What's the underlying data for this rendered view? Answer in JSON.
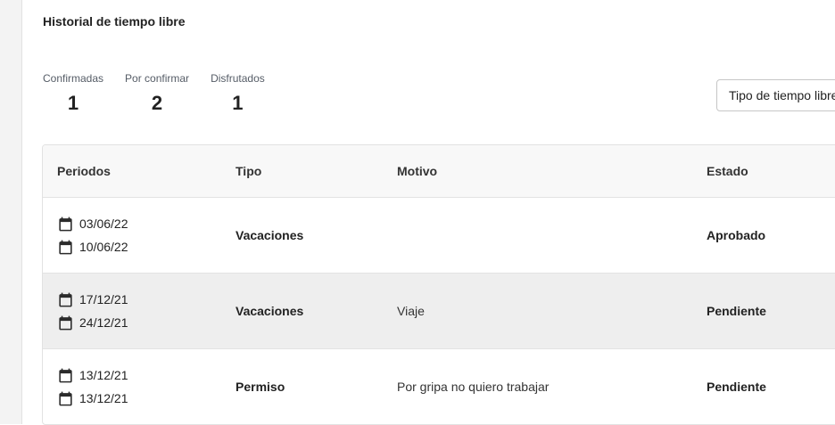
{
  "section": {
    "title": "Historial de tiempo libre"
  },
  "stats": [
    {
      "label": "Confirmadas",
      "value": "1"
    },
    {
      "label": "Por confirmar",
      "value": "2"
    },
    {
      "label": "Disfrutados",
      "value": "1"
    }
  ],
  "filter": {
    "label": "Tipo de tiempo libre"
  },
  "table": {
    "headers": {
      "period": "Periodos",
      "type": "Tipo",
      "reason": "Motivo",
      "status": "Estado"
    },
    "rows": [
      {
        "start": "03/06/22",
        "end": "10/06/22",
        "type": "Vacaciones",
        "reason": "",
        "status": "Aprobado"
      },
      {
        "start": "17/12/21",
        "end": "24/12/21",
        "type": "Vacaciones",
        "reason": "Viaje",
        "status": "Pendiente"
      },
      {
        "start": "13/12/21",
        "end": "13/12/21",
        "type": "Permiso",
        "reason": "Por gripa no quiero trabajar",
        "status": "Pendiente"
      }
    ]
  },
  "icons": {
    "date": "calendar-icon"
  }
}
